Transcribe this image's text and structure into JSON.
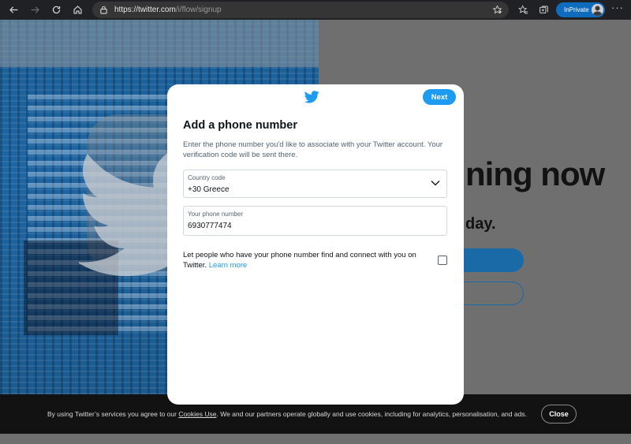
{
  "browser": {
    "url_host": "https://twitter.com",
    "url_path": "/i/flow/signup",
    "inprivate_label": "InPrivate"
  },
  "background_page": {
    "headline_fragment": "ning now",
    "sub_fragment": "day."
  },
  "modal": {
    "next_label": "Next",
    "title": "Add a phone number",
    "description": "Enter the phone number you'd like to associate with your Twitter account. Your verification code will be sent there.",
    "country_label": "Country code",
    "country_value": "+30 Greece",
    "phone_label": "Your phone number",
    "phone_value": "6930777474",
    "discover_text": "Let people who have your phone number find and connect with you on Twitter.",
    "learn_more": "Learn more",
    "discover_checked": false
  },
  "cookie_bar": {
    "text_before": "By using Twitter’s services you agree to our ",
    "link": "Cookies Use",
    "text_after": ". We and our partners operate globally and use cookies, including for analytics, personalisation, and ads.",
    "close_label": "Close"
  },
  "colors": {
    "twitter_blue": "#1d9bf0",
    "edge_accent": "#0f6cbd",
    "cookie_bg": "#121212"
  },
  "icons": [
    "back-icon",
    "forward-icon",
    "refresh-icon",
    "home-icon",
    "lock-icon",
    "favorite-star-icon",
    "favorites-icon",
    "collections-icon",
    "twitter-bird-icon",
    "chevron-down-icon"
  ]
}
